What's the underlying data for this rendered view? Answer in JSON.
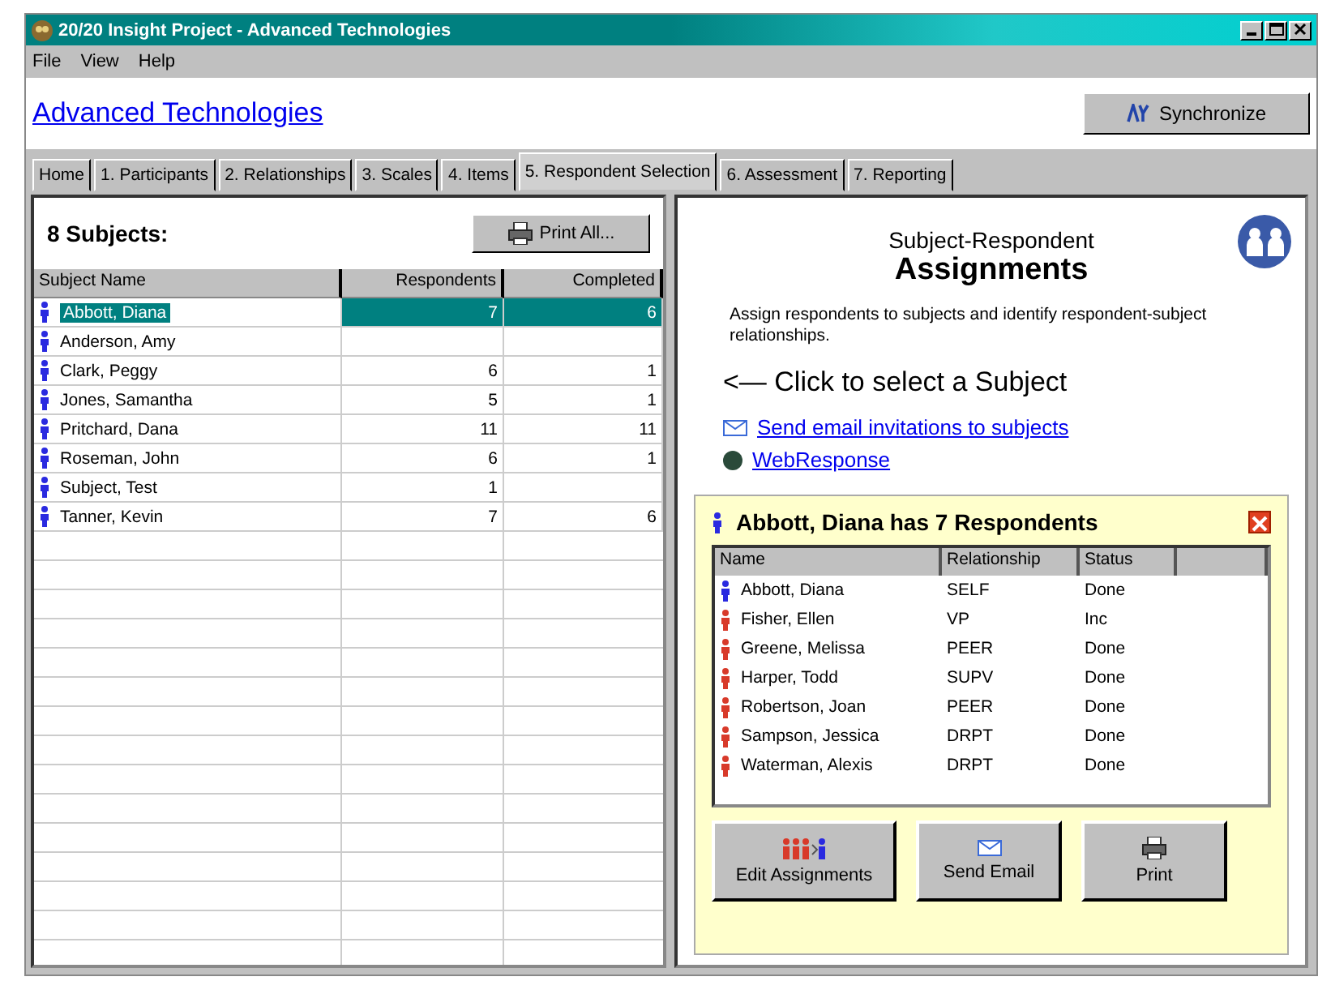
{
  "window": {
    "title": "20/20 Insight Project - Advanced Technologies"
  },
  "menu": [
    "File",
    "View",
    "Help"
  ],
  "header": {
    "title": "Advanced Technologies",
    "sync_button": "Synchronize"
  },
  "tabs": [
    {
      "label": "Home",
      "selected": false
    },
    {
      "label": "1. Participants",
      "selected": false
    },
    {
      "label": "2. Relationships",
      "selected": false
    },
    {
      "label": "3. Scales",
      "selected": false
    },
    {
      "label": "4. Items",
      "selected": false
    },
    {
      "label": "5. Respondent Selection",
      "selected": true
    },
    {
      "label": "6. Assessment",
      "selected": false
    },
    {
      "label": "7. Reporting",
      "selected": false
    }
  ],
  "subjects": {
    "count_label": "8 Subjects:",
    "print_button": "Print All...",
    "columns": [
      "Subject Name",
      "Respondents",
      "Completed"
    ],
    "rows": [
      {
        "name": "Abbott, Diana",
        "respondents": "7",
        "completed": "6",
        "selected": true
      },
      {
        "name": "Anderson, Amy",
        "selected": false
      },
      {
        "name": "Clark, Peggy",
        "respondents": "6",
        "completed": "1",
        "selected": false
      },
      {
        "name": "Jones, Samantha",
        "respondents": "5",
        "completed": "1",
        "selected": false
      },
      {
        "name": "Pritchard, Dana",
        "respondents": "11",
        "completed": "11",
        "selected": false
      },
      {
        "name": "Roseman, John",
        "respondents": "6",
        "completed": "1",
        "selected": false
      },
      {
        "name": "Subject, Test",
        "respondents": "1",
        "selected": false
      },
      {
        "name": "Tanner, Kevin",
        "respondents": "7",
        "completed": "6",
        "selected": false
      }
    ]
  },
  "assignments": {
    "subtitle": "Subject-Respondent",
    "title": "Assignments",
    "description": "Assign respondents to subjects and identify respondent-subject relationships.",
    "hint": "<— Click to select a Subject",
    "links": [
      {
        "kind": "email",
        "label": "Send email invitations to subjects"
      },
      {
        "kind": "web",
        "label": "WebResponse"
      }
    ]
  },
  "detail": {
    "title": "Abbott, Diana has 7 Respondents",
    "columns": [
      "Name",
      "Relationship",
      "Status"
    ],
    "rows": [
      {
        "name": "Abbott, Diana",
        "relationship": "SELF",
        "status": "Done",
        "color": "#2a2ae0"
      },
      {
        "name": "Fisher, Ellen",
        "relationship": "VP",
        "status": "Inc",
        "color": "#d83a2a"
      },
      {
        "name": "Greene, Melissa",
        "relationship": "PEER",
        "status": "Done",
        "color": "#d83a2a"
      },
      {
        "name": "Harper, Todd",
        "relationship": "SUPV",
        "status": "Done",
        "color": "#d83a2a"
      },
      {
        "name": "Robertson, Joan",
        "relationship": "PEER",
        "status": "Done",
        "color": "#d83a2a"
      },
      {
        "name": "Sampson, Jessica",
        "relationship": "DRPT",
        "status": "Done",
        "color": "#d83a2a"
      },
      {
        "name": "Waterman, Alexis",
        "relationship": "DRPT",
        "status": "Done",
        "color": "#d83a2a"
      }
    ],
    "buttons": [
      {
        "kind": "edit",
        "label": "Edit Assignments"
      },
      {
        "kind": "email",
        "label": "Send Email"
      },
      {
        "kind": "print",
        "label": "Print"
      }
    ]
  }
}
